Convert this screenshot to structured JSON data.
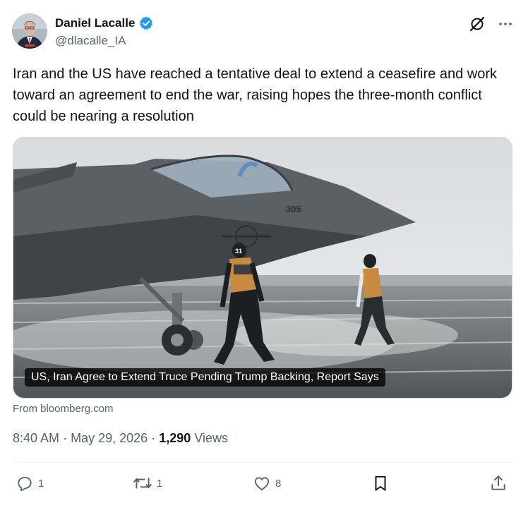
{
  "author": {
    "name": "Daniel Lacalle",
    "handle": "@dlacalle_IA",
    "verified": true,
    "badge_color": "#1d9bf0"
  },
  "top_icons": [
    "grok-icon",
    "more-icon"
  ],
  "text": "Iran and the US have reached a tentative deal to extend a ceasefire and work toward an agreement to end the war, raising hopes the three-month conflict could be nearing a resolution",
  "card": {
    "caption": "US, Iran Agree to Extend Truce Pending Trump Backing, Report Says",
    "source": "From bloomberg.com",
    "jet_number": "305",
    "crew_number": "31"
  },
  "meta": {
    "time": "8:40 AM",
    "separator": "·",
    "date": "May 29, 2026",
    "views_count": "1,290",
    "views_label": "Views"
  },
  "actions": {
    "replies": "1",
    "reposts": "1",
    "likes": "8"
  },
  "colors": {
    "text": "#0f1419",
    "secondary": "#536471",
    "divider": "#eff3f4"
  }
}
